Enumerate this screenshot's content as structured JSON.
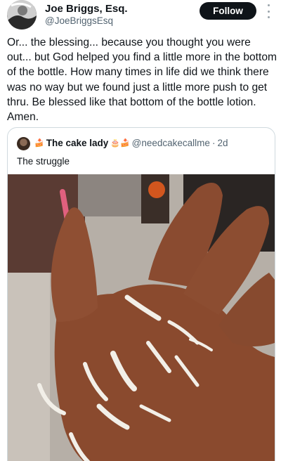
{
  "author": {
    "name": "Joe Briggs, Esq.",
    "handle": "@JoeBriggsEsq",
    "avatar_icon": "profile-photo-icon"
  },
  "follow_label": "Follow",
  "more_icon": "more-dots-icon",
  "tweet_text": "Or... the blessing... because you thought you were out... but God helped you find a little more in the bottom of the bottle. How many times in life did we think there was no way but we found just a little more push to get thru. Be blessed like that bottom of the bottle lotion. Amen.",
  "quoted_tweet": {
    "name": "The cake lady",
    "name_emoji_before": "🍰",
    "name_emoji_after": "🎂🍰",
    "handle": "@needcakecallme",
    "separator": "·",
    "time": "2d",
    "text": "The struggle",
    "media_description_icon": "photo-hand-with-lotion"
  },
  "colors": {
    "text": "#0f1419",
    "secondary": "#536471",
    "border": "#cfd9de",
    "follow_bg": "#0f1419"
  }
}
